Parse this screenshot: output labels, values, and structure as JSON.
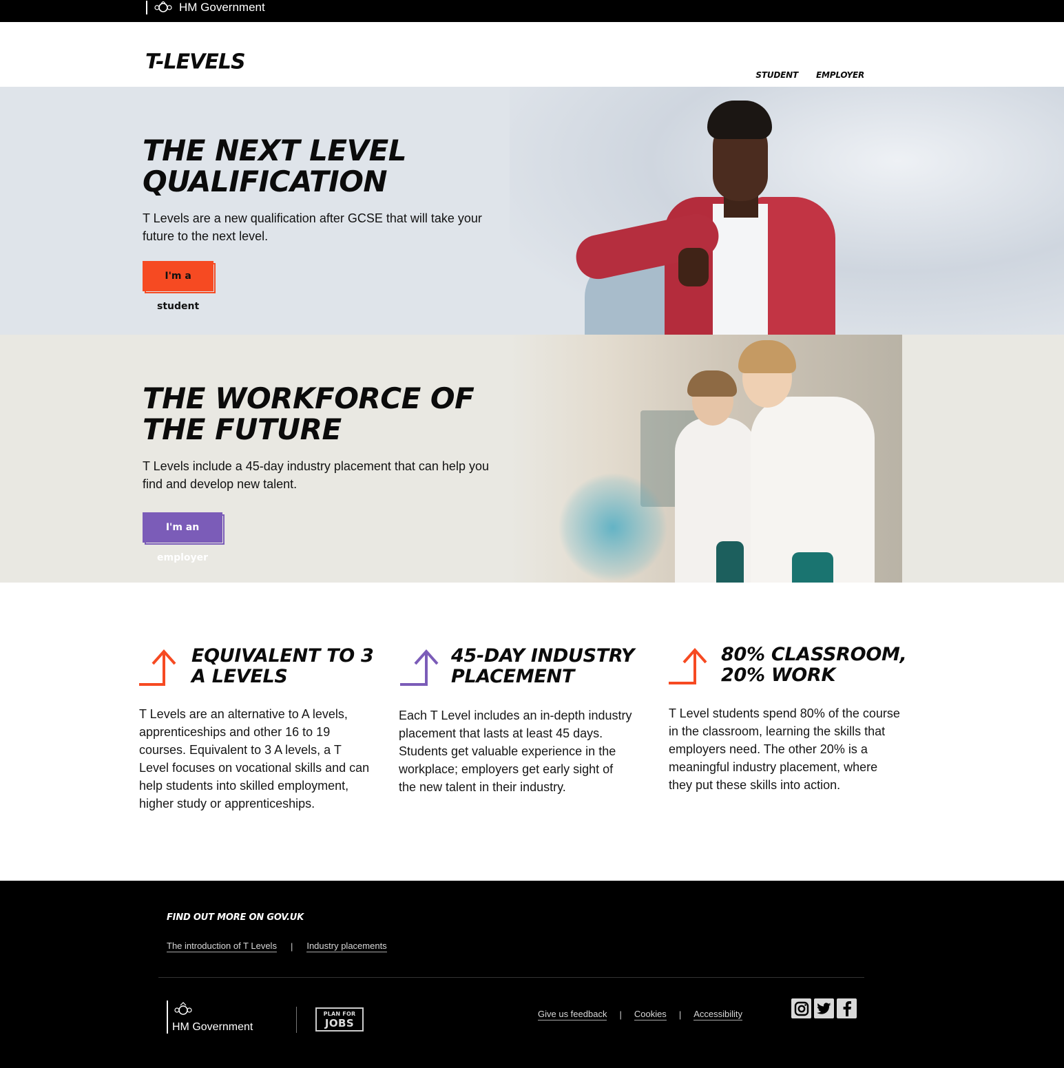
{
  "gov_bar": {
    "label": "HM Government"
  },
  "header": {
    "logo_text": "T-LEVELS",
    "nav": [
      {
        "label": "STUDENT"
      },
      {
        "label": "EMPLOYER"
      }
    ]
  },
  "hero_student": {
    "heading": "THE NEXT LEVEL QUALIFICATION",
    "body": "T Levels are a new qualification after GCSE that will take your future to the next level.",
    "cta": "I'm a student"
  },
  "hero_employer": {
    "heading": "THE WORKFORCE OF THE FUTURE",
    "body": "T Levels include a 45-day industry placement that can help you find and develop new talent.",
    "cta": "I'm an employer"
  },
  "features": [
    {
      "title": "EQUIVALENT TO 3 A LEVELS",
      "body": "T Levels are an alternative to A levels, apprenticeships and other 16 to 19 courses. Equivalent to 3 A levels, a T Level focuses on vocational skills and can help students into skilled employment, higher study or apprenticeships.",
      "arrow_color": "#f64a22"
    },
    {
      "title": "45-DAY INDUSTRY PLACEMENT",
      "body": "Each T Level includes an in-depth industry placement that lasts at least 45 days. Students get valuable experience in the workplace; employers get early sight of the new talent in their industry.",
      "arrow_color": "#7b5cb8"
    },
    {
      "title": "80% CLASSROOM, 20% WORK",
      "body": "T Level students spend 80% of the course in the classroom, learning the skills that employers need. The other 20% is a meaningful industry placement, where they put these skills into action.",
      "arrow_color": "#f64a22"
    }
  ],
  "footer": {
    "title": "FIND OUT MORE ON GOV.UK",
    "links": [
      {
        "label": "The introduction of T Levels"
      },
      {
        "label": "Industry placements"
      }
    ],
    "separator": "|",
    "gov_label": "HM Government",
    "plan_for_jobs": {
      "top": "PLAN FOR",
      "bottom": "JOBS"
    },
    "legal": [
      {
        "label": "Give us feedback"
      },
      {
        "label": "Cookies"
      },
      {
        "label": "Accessibility"
      }
    ],
    "social": [
      {
        "icon": "instagram-icon"
      },
      {
        "icon": "twitter-icon"
      },
      {
        "icon": "facebook-icon"
      }
    ]
  },
  "colors": {
    "accent_orange": "#f64a22",
    "accent_purple": "#7b5cb8",
    "hero_student_bg": "#dfe4ea",
    "hero_employer_bg": "#e9e8e2"
  }
}
